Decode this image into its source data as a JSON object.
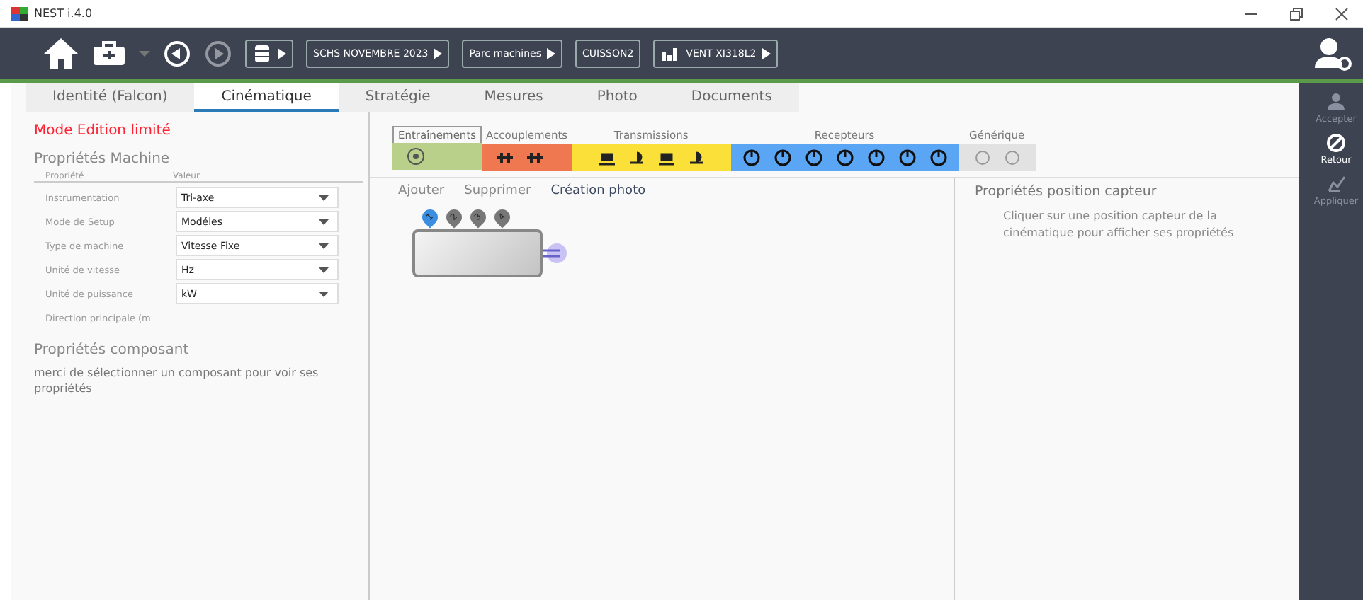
{
  "window": {
    "title": "NEST i.4.0"
  },
  "toolbar": {
    "back_disabled": false,
    "forward_disabled": true,
    "breadcrumbs": [
      {
        "label": "SCHS NOVEMBRE 2023",
        "arrow": true
      },
      {
        "label": "Parc machines",
        "arrow": true
      },
      {
        "label": "CUISSON2",
        "arrow": false
      },
      {
        "label": "VENT XI318L2",
        "arrow": true
      }
    ]
  },
  "tabs": [
    {
      "label": "Identité (Falcon)",
      "selected": false
    },
    {
      "label": "Cinématique",
      "selected": true
    },
    {
      "label": "Stratégie",
      "selected": false
    },
    {
      "label": "Mesures",
      "selected": false
    },
    {
      "label": "Photo",
      "selected": false
    },
    {
      "label": "Documents",
      "selected": false
    }
  ],
  "left_panel": {
    "mode_warning": "Mode Edition limité",
    "machine_title": "Propriétés Machine",
    "columns": [
      "Propriété",
      "Valeur"
    ],
    "properties": [
      {
        "name": "Instrumentation",
        "value": "Tri-axe"
      },
      {
        "name": "Mode de Setup",
        "value": "Modéles"
      },
      {
        "name": "Type de machine",
        "value": "Vitesse Fixe"
      },
      {
        "name": "Unité de vitesse",
        "value": "Hz"
      },
      {
        "name": "Unité de puissance",
        "value": "kW"
      },
      {
        "name": "Direction principale (m"
      }
    ],
    "component_title": "Propriétés composant",
    "component_hint": "merci de sélectionner un composant pour voir ses propriétés"
  },
  "palette": [
    {
      "label": "Entraînements",
      "color": "#b9d08a"
    },
    {
      "label": "Accouplements",
      "color": "#f07850"
    },
    {
      "label": "Transmissions",
      "color": "#fbe03a"
    },
    {
      "label": "Recepteurs",
      "color": "#5aa6f5"
    },
    {
      "label": "Générique",
      "color": "#e2e2e2"
    }
  ],
  "canvas": {
    "actions": [
      {
        "label": "Ajouter",
        "disabled": true
      },
      {
        "label": "Supprimer",
        "disabled": true
      },
      {
        "label": "Création photo",
        "disabled": false
      }
    ],
    "pins": [
      {
        "label": "1",
        "selected": true
      },
      {
        "label": "2",
        "selected": false
      },
      {
        "label": "3",
        "selected": false
      },
      {
        "label": "4",
        "selected": false
      }
    ]
  },
  "sensor_panel": {
    "title": "Propriétés position capteur",
    "hint": "Cliquer sur une position capteur de la cinématique pour afficher ses propriétés"
  },
  "sidebar": [
    {
      "label": "Accepter",
      "disabled": true
    },
    {
      "label": "Retour",
      "disabled": false
    },
    {
      "label": "Appliquer",
      "disabled": true
    }
  ]
}
